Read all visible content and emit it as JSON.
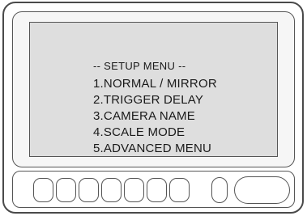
{
  "screen": {
    "menu_title": "-- SETUP MENU --",
    "items": [
      "1.NORMAL / MIRROR",
      "2.TRIGGER DELAY",
      "3.CAMERA NAME",
      "4.SCALE MODE",
      "5.ADVANCED MENU"
    ]
  },
  "colors": {
    "outline": "#4a4a4a",
    "screen_background": "#dedede",
    "text": "#1a1a1a"
  }
}
